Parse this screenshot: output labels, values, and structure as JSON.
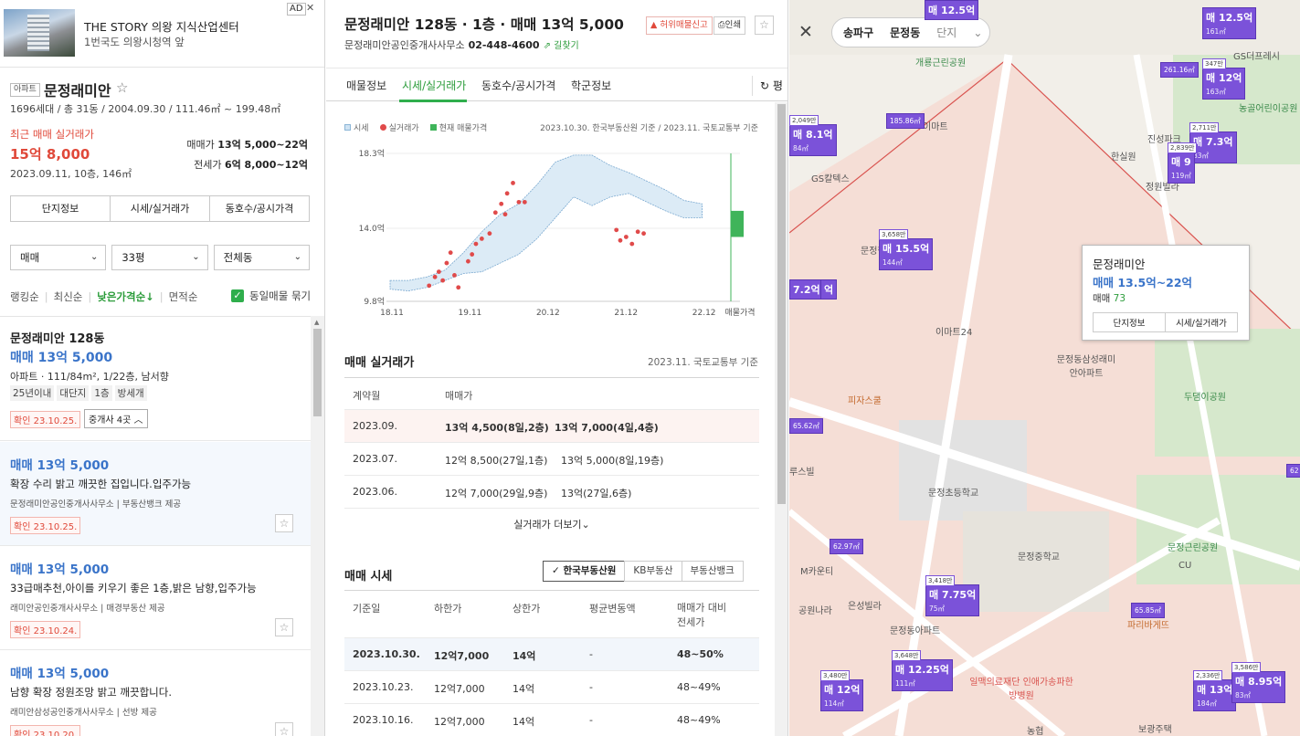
{
  "ad": {
    "badge": "AD",
    "close": "✕",
    "title": "THE STORY 의왕 지식산업센터",
    "subtitle": "1번국도 의왕시청역 앞"
  },
  "complex": {
    "tag": "아파트",
    "name": "문정래미안",
    "info": "1696세대 / 총 31동 / 2004.09.30 / 111.46㎡ ~ 199.48㎡",
    "recent_label": "최근 매매 실거래가",
    "recent_price": "15억 8,000",
    "recent_date": "2023.09.11, 10층, 146㎡",
    "sale_label": "매매가",
    "sale_range": "13억 5,000~22억",
    "lease_label": "전세가",
    "lease_range": "6억 8,000~12억"
  },
  "left_tabs": [
    "단지정보",
    "시세/실거래가",
    "동호수/공시가격"
  ],
  "filters": [
    {
      "value": "매매"
    },
    {
      "value": "33평"
    },
    {
      "value": "전체동"
    }
  ],
  "sort": {
    "items": [
      "랭킹순",
      "최신순",
      "낮은가격순↓",
      "면적순"
    ],
    "same_listing": "동일매물 묶기"
  },
  "main_listing": {
    "title": "문정래미안 128동",
    "price": "매매 13억 5,000",
    "spec": "아파트 · 111/84m², 1/22층, 남서향",
    "tags": [
      "25년이내",
      "대단지",
      "1층",
      "방세개"
    ],
    "confirm": "확인 23.10.25.",
    "agents": "중개사 4곳 ︿"
  },
  "listings": [
    {
      "price": "매매 13억 5,000",
      "desc": "확장 수리 밝고 깨끗한 집입니다.입주가능",
      "agent": "문정래미안공인중개사사무소 | 부동산뱅크 제공",
      "confirm": "확인 23.10.25."
    },
    {
      "price": "매매 13억 5,000",
      "desc": "33급매추천,아이를 키우기 좋은 1층,밝은 남향,입주가능",
      "agent": "래미안공인중개사사무소 | 매경부동산 제공",
      "confirm": "확인 23.10.24."
    },
    {
      "price": "매매 13억 5,000",
      "desc": "남향 확장 정원조망 밝고 깨끗합니다.",
      "agent": "래미안삼성공인중개사사무소 | 선방 제공",
      "confirm": "확인 23.10.20."
    }
  ],
  "detail": {
    "title": "문정래미안 128동 · 1층 · 매매 13억 5,000",
    "agent_name": "문정래미안공인중개사사무소",
    "agent_phone": "02-448-4600",
    "route": "⇗ 길찾기",
    "report_btn": "허위매물신고",
    "print_btn": "인쇄",
    "tabs": [
      "매물정보",
      "시세/실거래가",
      "동호수/공시가격",
      "학군정보"
    ],
    "refresh": "평"
  },
  "chart_legend": [
    "시세",
    "실거래가",
    "현재 매물가격"
  ],
  "chart_source": "2023.10.30. 한국부동산원 기준 / 2023.11. 국토교통부 기준",
  "chart_data": {
    "type": "area",
    "y_ticks": [
      "18.3억",
      "14.0억",
      "9.8억"
    ],
    "x_ticks": [
      "18.11",
      "19.11",
      "20.12",
      "21.12",
      "22.12",
      "매물가격"
    ],
    "ylim": [
      9.8,
      18.3
    ],
    "series": [
      {
        "name": "시세",
        "lower": [
          10.5,
          10.4,
          10.6,
          11.0,
          11.4,
          11.5,
          12.0,
          12.5,
          13.4,
          14.6,
          15.8,
          15.3,
          15.8,
          16.0,
          15.5,
          15.0,
          14.6,
          14.6
        ],
        "upper": [
          11.0,
          11.0,
          11.2,
          11.6,
          12.6,
          13.8,
          14.8,
          15.4,
          16.5,
          17.8,
          18.2,
          18.2,
          17.6,
          17.2,
          16.7,
          16.2,
          15.6,
          15.4
        ]
      },
      {
        "name": "실거래가",
        "points": [
          [
            2.0,
            10.7
          ],
          [
            2.3,
            11.2
          ],
          [
            2.5,
            11.5
          ],
          [
            2.7,
            11.0
          ],
          [
            2.9,
            12.0
          ],
          [
            3.1,
            12.6
          ],
          [
            3.3,
            11.3
          ],
          [
            3.5,
            10.6
          ],
          [
            4.0,
            12.1
          ],
          [
            4.2,
            12.5
          ],
          [
            4.4,
            13.1
          ],
          [
            4.7,
            13.4
          ],
          [
            5.1,
            13.7
          ],
          [
            5.4,
            14.9
          ],
          [
            5.7,
            15.4
          ],
          [
            5.9,
            14.8
          ],
          [
            6.0,
            16.0
          ],
          [
            6.3,
            16.6
          ],
          [
            6.6,
            15.5
          ],
          [
            6.9,
            15.5
          ],
          [
            11.6,
            13.9
          ],
          [
            11.8,
            13.3
          ],
          [
            12.1,
            13.5
          ],
          [
            12.4,
            13.1
          ],
          [
            12.7,
            13.8
          ],
          [
            13.0,
            13.7
          ]
        ]
      },
      {
        "name": "현재 매물가격",
        "range": [
          13.5,
          15.0
        ]
      }
    ]
  },
  "transactions": {
    "title": "매매 실거래가",
    "source": "2023.11. 국토교통부 기준",
    "headers": [
      "계약월",
      "매매가"
    ],
    "rows": [
      {
        "month": "2023.09.",
        "p1": "13억 4,500(8일,2층)",
        "p2": "13억 7,000(4일,4층)"
      },
      {
        "month": "2023.07.",
        "p1": "12억 8,500(27일,1층)",
        "p2": "13억 5,000(8일,19층)"
      },
      {
        "month": "2023.06.",
        "p1": "12억 7,000(29일,9층)",
        "p2": "13억(27일,6층)"
      }
    ],
    "more": "실거래가 더보기⌄"
  },
  "market": {
    "title": "매매 시세",
    "sources": [
      "✓ 한국부동산원",
      "KB부동산",
      "부동산뱅크"
    ],
    "headers": [
      "기준일",
      "하한가",
      "상한가",
      "평균변동액",
      "매매가 대비 전세가"
    ],
    "rows": [
      {
        "date": "2023.10.30.",
        "low": "12억7,000",
        "high": "14억",
        "avg": "-",
        "ratio": "48~50%"
      },
      {
        "date": "2023.10.23.",
        "low": "12억7,000",
        "high": "14억",
        "avg": "-",
        "ratio": "48~49%"
      },
      {
        "date": "2023.10.16.",
        "low": "12억7,000",
        "high": "14억",
        "avg": "-",
        "ratio": "48~49%"
      }
    ]
  },
  "map": {
    "close": "✕",
    "crumbs": [
      "송파구",
      "문정동",
      "단지"
    ],
    "popup": {
      "name": "문정래미안",
      "price": "매매 13.5억~22억",
      "count_label": "매매",
      "count": "73",
      "btn1": "단지정보",
      "btn2": "시세/실거래가"
    },
    "markers": [
      {
        "price": "매 12.5억",
        "area": "",
        "top": ""
      },
      {
        "price": "매 12.5억",
        "area": "161㎡",
        "top": ""
      },
      {
        "price": "매 12억",
        "area": "163㎡",
        "top": "347만"
      },
      {
        "price": "매 8.1억",
        "area": "84㎡",
        "top": "2,049만"
      },
      {
        "price": "매 7.3억",
        "area": "83㎡",
        "top": "2,711만"
      },
      {
        "price": "매 9",
        "area": "119㎡",
        "top": "2,839만"
      },
      {
        "price": "매 15.5억",
        "area": "144㎡",
        "top": "3,658만"
      },
      {
        "price": "7.2억",
        "area": "",
        "top": ""
      },
      {
        "price": "억",
        "area": "",
        "top": "만"
      },
      {
        "price": "매 7.75억",
        "area": "75㎡",
        "top": "3,418만"
      },
      {
        "price": "매 12.25억",
        "area": "111㎡",
        "top": "3,648만"
      },
      {
        "price": "매 12억",
        "area": "114㎡",
        "top": "3,480만"
      },
      {
        "price": "매 13억",
        "area": "184㎡",
        "top": "2,336만"
      },
      {
        "price": "매 8.95억",
        "area": "83㎡",
        "top": "3,586만"
      }
    ],
    "small_markers": [
      "185.86㎡",
      "261.16㎡",
      "62.97㎡",
      "65.85㎡",
      "65.62㎡",
      "62"
    ],
    "labels": [
      "개룡근린공원",
      "GS더프레시",
      "농골어린이공원",
      "한실원",
      "진성파크",
      "GS칼텍스",
      "정원빌라",
      "문정현대1차",
      "이마트24",
      "문정동삼성래미안아파트",
      "두댐이공원",
      "피자스쿨",
      "문정초등학교",
      "문정중학교",
      "문정근린공원",
      "M카운티",
      "은성빌라",
      "공원나라",
      "문정동아파트",
      "일맥의료재단 인애가송파한방병원",
      "파리바게뜨",
      "CU",
      "보광주택",
      "농협",
      "루스빌",
      "이마트"
    ]
  }
}
